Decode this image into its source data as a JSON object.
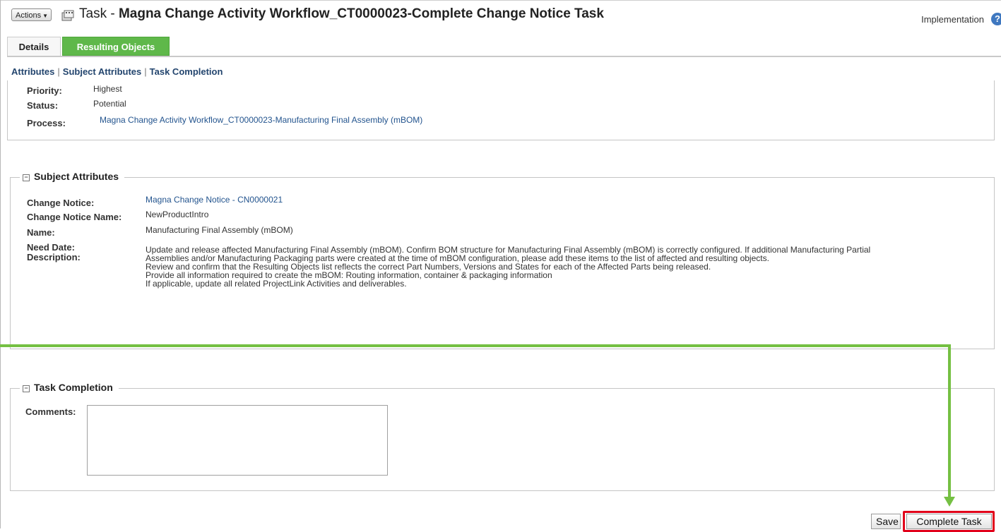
{
  "header": {
    "actions_label": "Actions",
    "title_prefix": "Task - ",
    "title_bold": "Magna Change Activity Workflow_CT0000023-Complete Change Notice Task",
    "context": "Implementation",
    "help_glyph": "?"
  },
  "tabs": [
    {
      "label": "Details",
      "active": true
    },
    {
      "label": "Resulting Objects",
      "active": false
    }
  ],
  "subnav": [
    "Attributes",
    "Subject Attributes",
    "Task Completion"
  ],
  "attributes": {
    "priority_label": "Priority:",
    "priority_value": "Highest",
    "status_label": "Status:",
    "status_value": "Potential",
    "process_label": "Process:",
    "process_value": "Magna Change Activity Workflow_CT0000023-Manufacturing Final Assembly (mBOM)"
  },
  "subject_attributes": {
    "legend": "Subject Attributes",
    "change_notice_label": "Change Notice:",
    "change_notice_value": "Magna Change Notice - CN0000021",
    "change_notice_name_label": "Change Notice Name:",
    "change_notice_name_value": "NewProductIntro",
    "name_label": "Name:",
    "name_value": "Manufacturing Final Assembly (mBOM)",
    "need_date_label": "Need Date:",
    "description_label": "Description:",
    "description_lines": [
      "Update and release affected Manufacturing Final Assembly (mBOM). Confirm BOM structure for Manufacturing Final Assembly (mBOM) is correctly configured. If additional Manufacturing Partial",
      "Assemblies and/or Manufacturing Packaging parts were created at the time of mBOM configuration, please add these items to the list of affected and resulting objects.",
      "Review and confirm that the Resulting Objects list reflects the correct Part Numbers, Versions and States for each of the Affected Parts being released.",
      "Provide all information required to create the mBOM: Routing information, container & packaging information",
      "If applicable, update all related ProjectLink Activities and deliverables."
    ]
  },
  "task_completion": {
    "legend": "Task Completion",
    "comments_label": "Comments:",
    "comments_value": ""
  },
  "buttons": {
    "save": "Save",
    "complete": "Complete Task"
  },
  "colors": {
    "accent_green": "#75c043",
    "highlight_red": "#e1001a",
    "link_blue": "#23548e"
  }
}
